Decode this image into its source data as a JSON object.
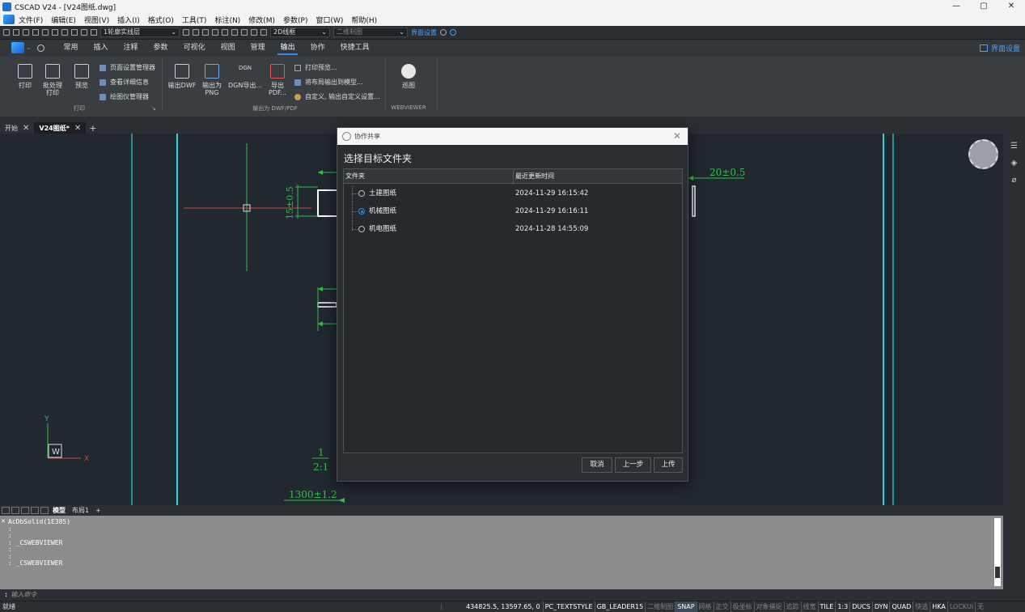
{
  "window": {
    "title": "CSCAD V24 - [V24图纸.dwg]",
    "controls": [
      "—",
      "▢",
      "✕"
    ]
  },
  "menu": {
    "items": [
      "文件(F)",
      "编辑(E)",
      "视图(V)",
      "插入(I)",
      "格式(O)",
      "工具(T)",
      "标注(N)",
      "修改(M)",
      "参数(P)",
      "窗口(W)",
      "帮助(H)"
    ],
    "mdi": [
      "_",
      "#",
      "×"
    ]
  },
  "quickbar": {
    "layer": "1轮廓实线层",
    "mode": "2D线框",
    "view": "二维制图",
    "ui_settings": "界面设置"
  },
  "ribbon": {
    "tabs": [
      "常用",
      "插入",
      "注释",
      "参数",
      "可视化",
      "视图",
      "管理",
      "输出",
      "协作",
      "快捷工具"
    ],
    "active_tab": "输出",
    "ui_settings": "界面设置",
    "print": {
      "print": "打印",
      "batch_line1": "批处理",
      "batch_line2": "打印",
      "preview": "预览",
      "page_setup": "页面设置管理器",
      "details": "查看详细信息",
      "plotter": "绘图仪管理器",
      "group": "打印"
    },
    "export": {
      "dwf": "输出DWF",
      "png_line1": "输出为",
      "png_line2": "PNG",
      "dgn_icon": "DGN",
      "dgn": "DGN导出...",
      "pdf_line1": "导出",
      "pdf_line2": "PDF...",
      "print_preview": "打印预览...",
      "layout_to_model": "将布局输出到模型...",
      "custom": "自定义, 输出自定义设置...",
      "group": "输出为 DWF/PDF"
    },
    "webviewer": {
      "btn": "巡图",
      "group": "WEBVIEWER"
    }
  },
  "doc_tabs": {
    "start": "开始",
    "current": "V24图纸*"
  },
  "drawing": {
    "dim1": "20±0.5",
    "dim2": "15±0.5",
    "scale_num": "1",
    "scale_den": "2:1",
    "dim3": "1300±1.2",
    "ucs_y": "Y",
    "ucs_w": "W",
    "ucs_x": "X"
  },
  "layout_tabs": {
    "model": "模型",
    "layout1": "布局1"
  },
  "command": {
    "lines": [
      "AcDbSolid(1E385)",
      ":",
      "",
      ":",
      "",
      ": _CSWEBVIEWER",
      "",
      ":",
      ":",
      ": _CSWEBVIEWER"
    ],
    "prompt": "输入命令"
  },
  "status": {
    "ready": "就绪",
    "coords": "434825.5, 13597.65, 0",
    "items": [
      {
        "label": "PC_TEXTSTYLE",
        "state": "on"
      },
      {
        "label": "GB_LEADER15",
        "state": "on"
      },
      {
        "label": "二维制图",
        "state": "off"
      },
      {
        "label": "SNAP",
        "state": "hl"
      },
      {
        "label": "网格",
        "state": "off"
      },
      {
        "label": "正交",
        "state": "off"
      },
      {
        "label": "极坐标",
        "state": "off"
      },
      {
        "label": "对象捕捉",
        "state": "off"
      },
      {
        "label": "追踪",
        "state": "off"
      },
      {
        "label": "线宽",
        "state": "off"
      },
      {
        "label": "TILE",
        "state": "on"
      },
      {
        "label": "1:3",
        "state": "on"
      },
      {
        "label": "DUCS",
        "state": "on"
      },
      {
        "label": "DYN",
        "state": "on"
      },
      {
        "label": "QUAD",
        "state": "on"
      },
      {
        "label": "快选",
        "state": "off"
      },
      {
        "label": "HKA",
        "state": "on"
      },
      {
        "label": "LOCKUI",
        "state": "off"
      },
      {
        "label": "无",
        "state": "off"
      }
    ]
  },
  "dialog": {
    "title": "协作共享",
    "heading": "选择目标文件夹",
    "col_folder": "文件夹",
    "col_time": "最近更新时间",
    "rows": [
      {
        "name": "土建图纸",
        "time": "2024-11-29 16:15:42",
        "selected": false
      },
      {
        "name": "机械图纸",
        "time": "2024-11-29 16:16:11",
        "selected": true
      },
      {
        "name": "机电图纸",
        "time": "2024-11-28 14:55:09",
        "selected": false
      }
    ],
    "cancel": "取消",
    "back": "上一步",
    "upload": "上传"
  }
}
